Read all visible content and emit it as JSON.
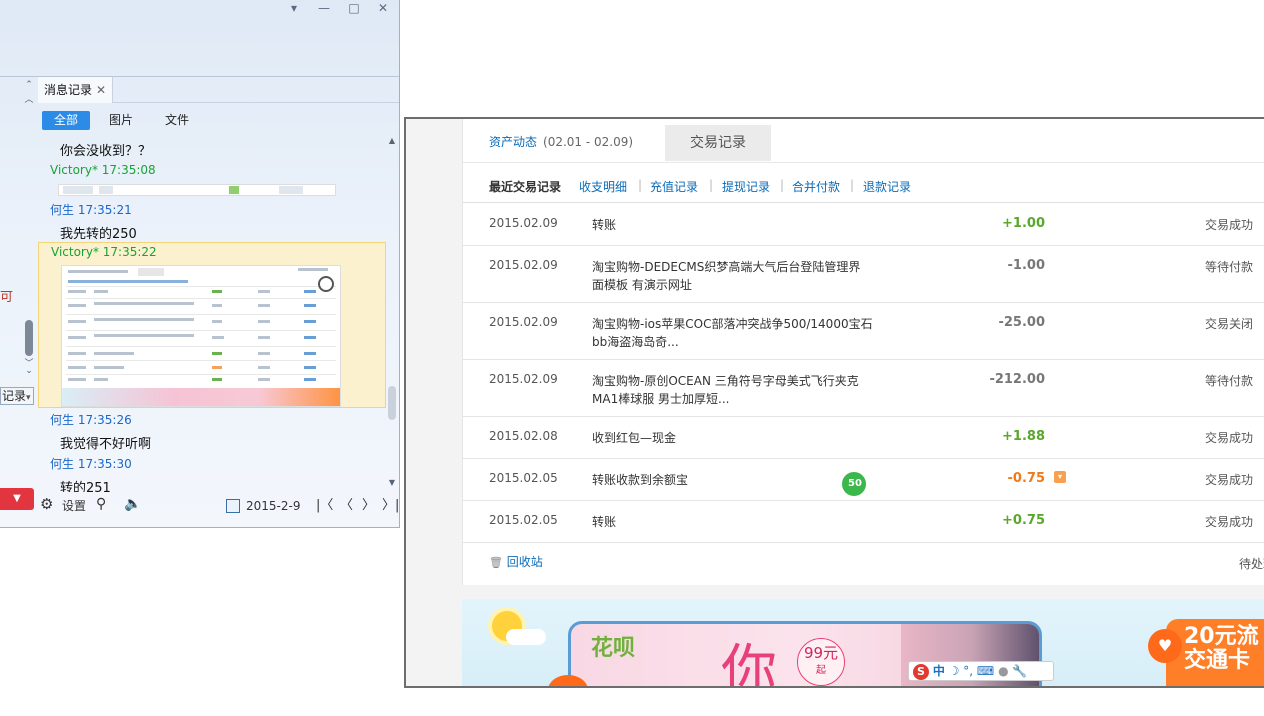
{
  "qq": {
    "controls": {
      "menu": "▾",
      "minimize": "—",
      "maximize": "□",
      "close": "✕"
    },
    "left_strip": {
      "char": "可",
      "record_label": "记录",
      "record_arrow": "▾",
      "red_button_arrow": "▼"
    },
    "tab": {
      "label": "消息记录",
      "close": "✕"
    },
    "filters": [
      "全部",
      "图片",
      "文件"
    ],
    "chat": [
      {
        "kind": "text",
        "value": "你会没收到？？"
      },
      {
        "kind": "sender",
        "value": "Victory* 17:35:08"
      },
      {
        "kind": "sender",
        "value": "何生 17:35:21"
      },
      {
        "kind": "text",
        "value": "我先转的250"
      },
      {
        "kind": "sender",
        "value": "Victory* 17:35:22"
      },
      {
        "kind": "sender",
        "value": "何生 17:35:26"
      },
      {
        "kind": "text",
        "value": "我觉得不好听啊"
      },
      {
        "kind": "sender",
        "value": "何生 17:35:30"
      },
      {
        "kind": "text",
        "value": "转的251"
      }
    ],
    "bottom": {
      "settings": "设置",
      "date": "2015-2-9"
    }
  },
  "alipay": {
    "tabs": {
      "asset": "资产动态",
      "asset_range": "(02.01 - 02.09)",
      "trade": "交易记录"
    },
    "subnav": {
      "title": "最近交易记录",
      "links": [
        "收支明细",
        "充值记录",
        "提现记录",
        "合并付款",
        "退款记录"
      ],
      "separator": "|"
    },
    "rows": [
      {
        "date": "2015.02.09",
        "name": "转账",
        "amount": "+1.00",
        "status": "交易成功",
        "tone": "pos"
      },
      {
        "date": "2015.02.09",
        "name": "淘宝购物-DEDECMS织梦高端大气后台登陆管理界面模板 有演示网址",
        "amount": "-1.00",
        "status": "等待付款",
        "tone": "neg"
      },
      {
        "date": "2015.02.09",
        "name": "淘宝购物-ios苹果COC部落冲突战争500/14000宝石bb海盗海岛奇...",
        "amount": "-25.00",
        "status": "交易关闭",
        "tone": "neg"
      },
      {
        "date": "2015.02.09",
        "name": "淘宝购物-原创OCEAN 三角符号字母美式飞行夹克MA1棒球服 男士加厚短...",
        "amount": "-212.00",
        "status": "等待付款",
        "tone": "neg"
      },
      {
        "date": "2015.02.08",
        "name": "收到红包—现金",
        "amount": "+1.88",
        "status": "交易成功",
        "tone": "pos"
      },
      {
        "date": "2015.02.05",
        "name": "转账收款到余额宝",
        "amount": "-0.75",
        "status": "交易成功",
        "tone": "orange"
      },
      {
        "date": "2015.02.05",
        "name": "转账",
        "amount": "+0.75",
        "status": "交易成功",
        "tone": "pos"
      }
    ],
    "recycle": "回收站",
    "pending": "待处理",
    "banner": {
      "logo": "花呗",
      "big_text": "你",
      "badge_price": "99元",
      "badge_suffix": "起",
      "right_text_1": "20元流",
      "right_text_2": "交通卡",
      "green_badge": "50",
      "ime": [
        "S",
        "中",
        "☽",
        "°,",
        "⌨",
        "●",
        "🔧"
      ]
    }
  }
}
